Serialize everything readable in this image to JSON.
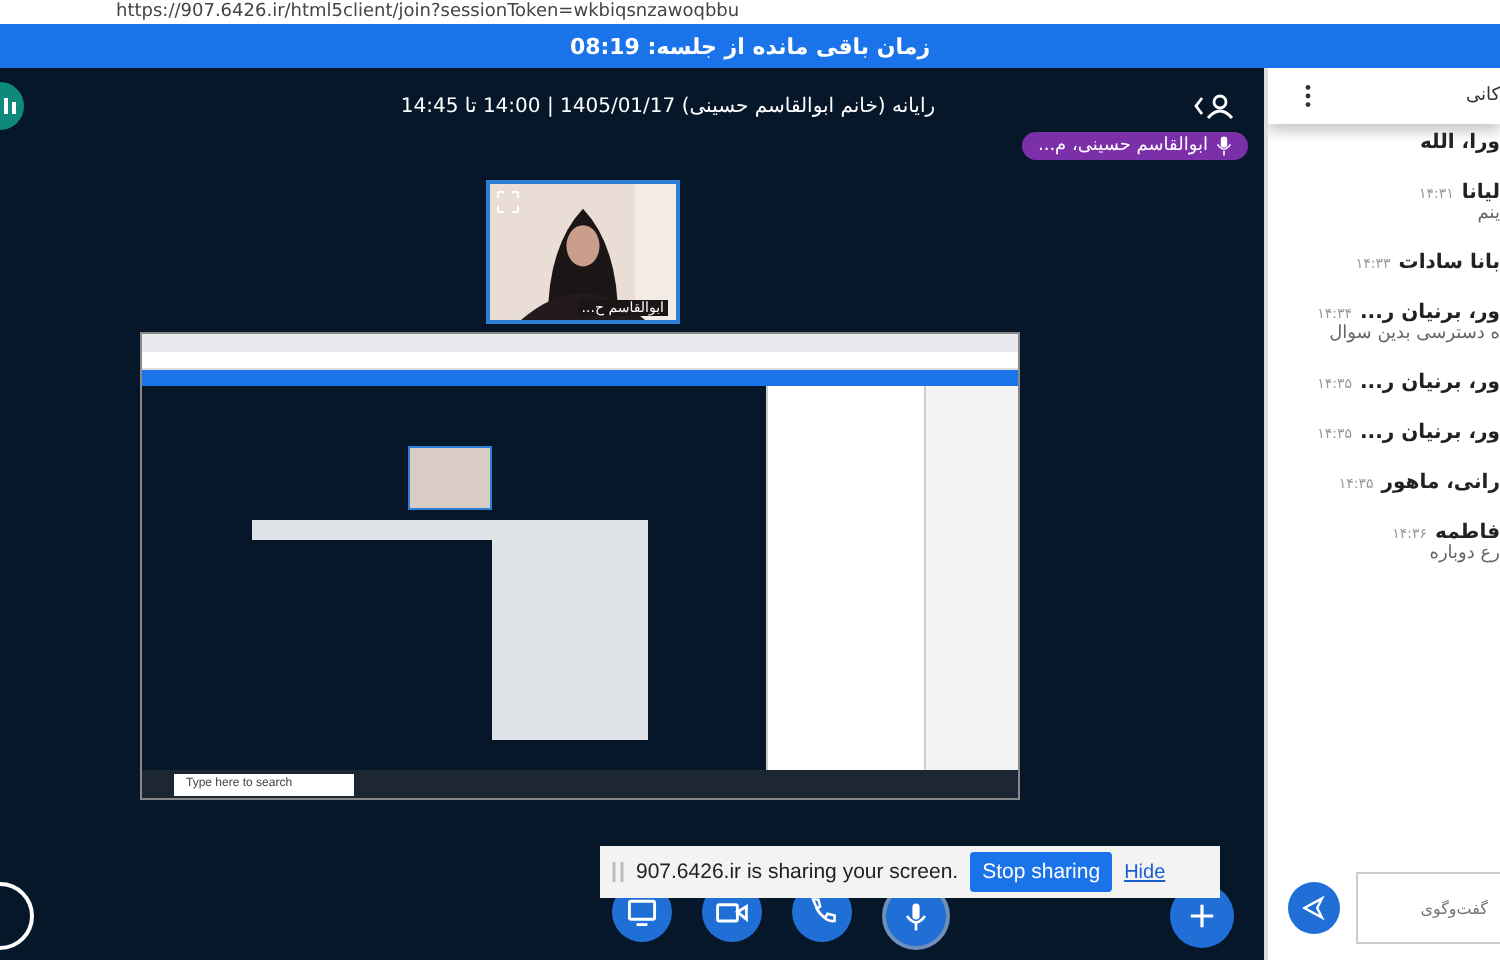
{
  "address_bar": {
    "url": "https://907.6426.ir/html5client/join?sessionToken=wkbiqsnzawoqbbu"
  },
  "timer_bar": {
    "text": "زمان باقی مانده از جلسه: 08:19"
  },
  "meeting": {
    "title": "رایانه (خانم ابوالقاسم حسینی) 1405/01/17 | 14:00 تا 14:45",
    "talking": "ابوالقاسم حسینی، م...",
    "webcam": {
      "name": "ابوالقاسم ح..."
    }
  },
  "shared_screen": {
    "taskbar_search": "Type here to search"
  },
  "share_notice": {
    "text": "907.6426.ir is sharing your screen.",
    "stop": "Stop sharing",
    "hide": "Hide"
  },
  "controls": [
    {
      "kind": "screen"
    },
    {
      "kind": "camera"
    },
    {
      "kind": "phone"
    },
    {
      "kind": "mic"
    }
  ],
  "chat": {
    "title": "کانی",
    "messages": [
      {
        "name": "ورا، الله"
      },
      {
        "name": "لیانا",
        "time": "۱۴:۳۱",
        "text": "ینم"
      },
      {
        "name": "بانا سادات",
        "time": "۱۴:۳۳"
      },
      {
        "name": "ور، برنیان ر...",
        "time": "۱۴:۳۴",
        "text": "ه دسترسی بدین سوال"
      },
      {
        "name": "ور، برنیان ر...",
        "time": "۱۴:۳۵"
      },
      {
        "name": "ور، برنیان ر...",
        "time": "۱۴:۳۵"
      },
      {
        "name": "رانی، ماهور",
        "time": "۱۴:۳۵"
      },
      {
        "name": "فاطمه",
        "time": "۱۴:۳۶",
        "text": "رع دوباره"
      }
    ],
    "input": {
      "placeholder": "گفت‌وگوی"
    }
  }
}
